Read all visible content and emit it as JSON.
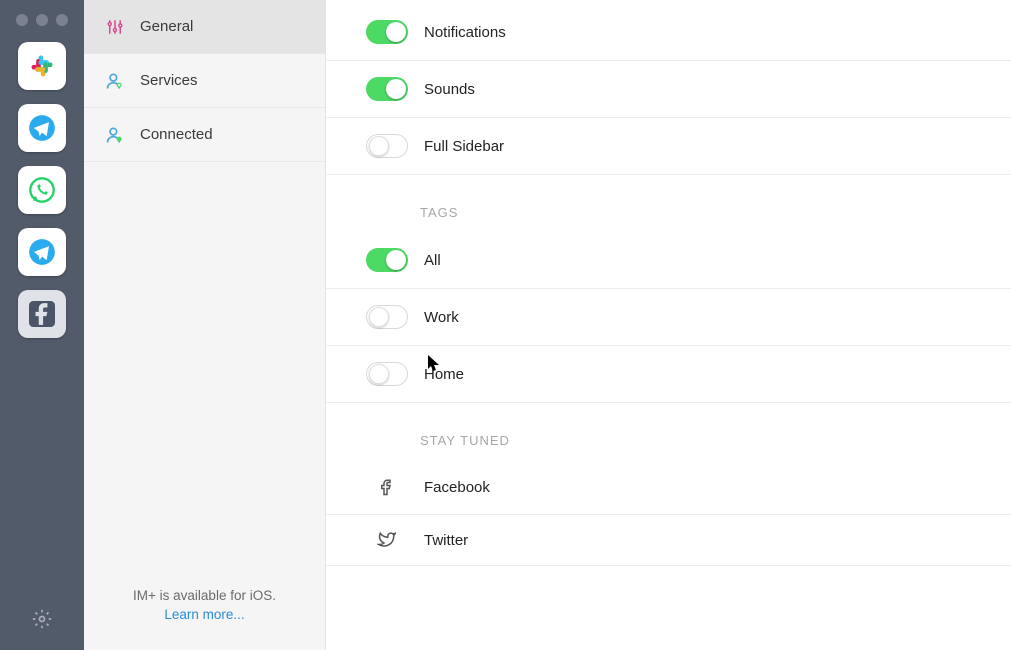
{
  "nav": {
    "items": [
      {
        "label": "General"
      },
      {
        "label": "Services"
      },
      {
        "label": "Connected"
      }
    ],
    "footer_text": "IM+ is available for iOS.",
    "footer_link": "Learn more..."
  },
  "settings": {
    "notifications": {
      "label": "Notifications",
      "on": true
    },
    "sounds": {
      "label": "Sounds",
      "on": true
    },
    "full_sidebar": {
      "label": "Full Sidebar",
      "on": false
    }
  },
  "sections": {
    "tags_header": "TAGS",
    "stay_tuned_header": "STAY TUNED"
  },
  "tags": {
    "all": {
      "label": "All",
      "on": true
    },
    "work": {
      "label": "Work",
      "on": false
    },
    "home": {
      "label": "Home",
      "on": false
    }
  },
  "social": {
    "facebook": {
      "label": "Facebook"
    },
    "twitter": {
      "label": "Twitter"
    }
  },
  "rail_apps": {
    "slack": "Slack",
    "telegram1": "Telegram",
    "whatsapp": "WhatsApp",
    "telegram2": "Telegram",
    "facebook": "Facebook"
  }
}
